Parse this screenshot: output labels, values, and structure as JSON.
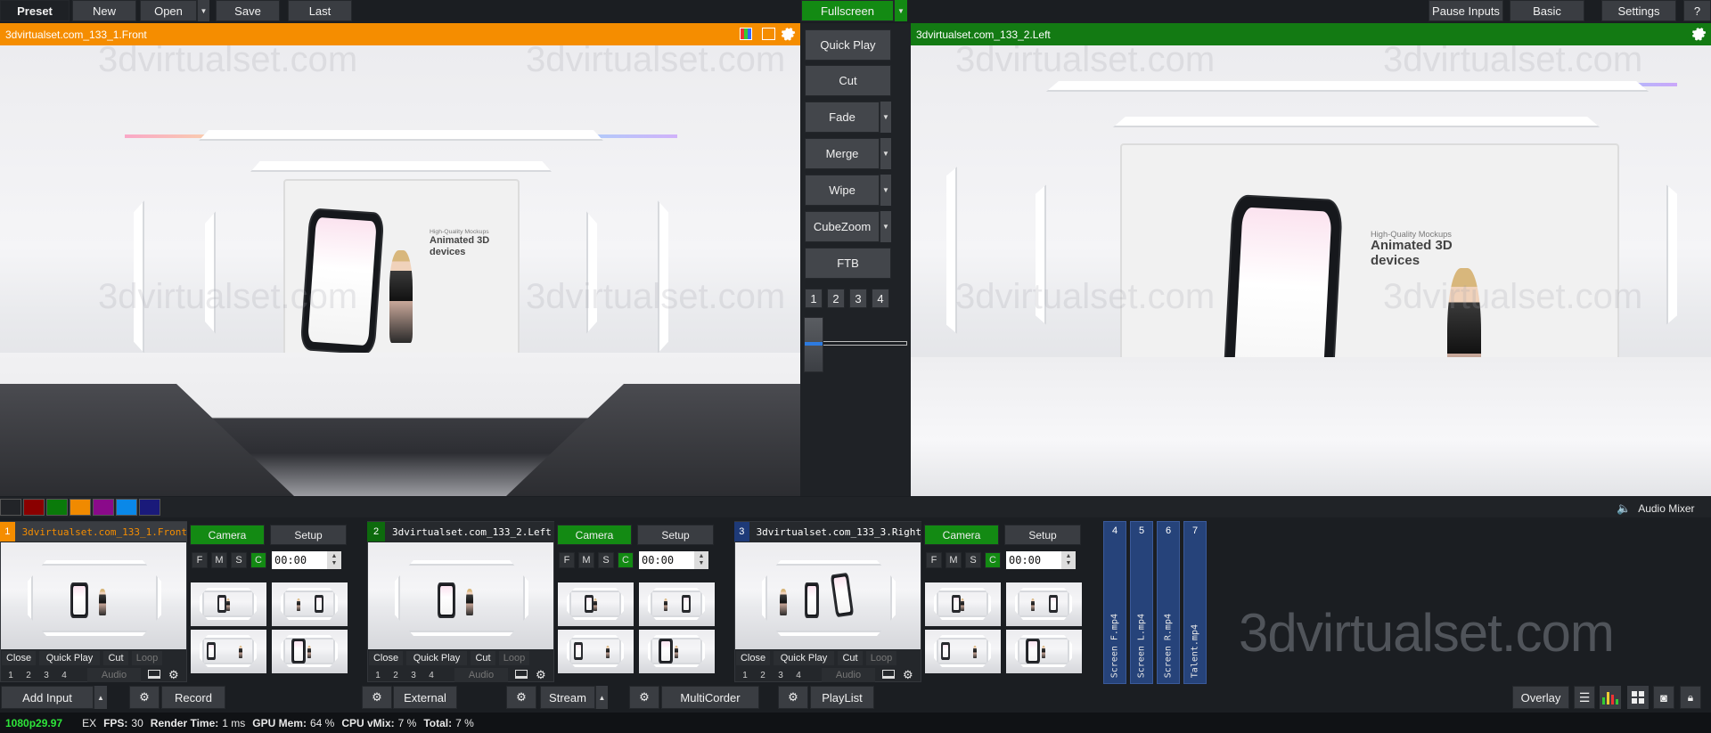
{
  "topbar": {
    "preset": "Preset",
    "new": "New",
    "open": "Open",
    "save": "Save",
    "last": "Last",
    "fullscreen": "Fullscreen",
    "pause_inputs": "Pause Inputs",
    "basic": "Basic",
    "settings": "Settings",
    "help": "?"
  },
  "preview": {
    "title": "3dvirtualset.com_133_1.Front",
    "color": "#f58d00"
  },
  "output": {
    "title": "3dvirtualset.com_133_2.Left",
    "color": "#137a13"
  },
  "scene_text": {
    "mockup_small": "High-Quality Mockups",
    "mockup_big": "Animated 3D devices",
    "watermark": "3dvirtualset.com"
  },
  "transitions": {
    "quick_play": "Quick Play",
    "cut": "Cut",
    "fade": "Fade",
    "merge": "Merge",
    "wipe": "Wipe",
    "cubezoom": "CubeZoom",
    "ftb": "FTB",
    "slots": [
      "1",
      "2",
      "3",
      "4"
    ]
  },
  "color_swatches": [
    "#222428",
    "#8a0000",
    "#0a7a0a",
    "#f08a00",
    "#8a0a8a",
    "#0a88e8",
    "#1a1a7a"
  ],
  "audio_mixer": "Audio Mixer",
  "inputs": [
    {
      "num": "1",
      "title": "3dvirtualset.com_133_1.Front",
      "color": "#f58d00",
      "title_color": "#f58d00"
    },
    {
      "num": "2",
      "title": "3dvirtualset.com_133_2.Left",
      "color": "#0d6a0d",
      "title_color": "#ffffff"
    },
    {
      "num": "3",
      "title": "3dvirtualset.com_133_3.Right",
      "color": "#1e3a78",
      "title_color": "#ffffff"
    }
  ],
  "input_controls": {
    "camera": "Camera",
    "setup": "Setup",
    "f": "F",
    "m": "M",
    "s": "S",
    "c": "C",
    "time": "00:00",
    "close": "Close",
    "quick_play": "Quick Play",
    "cut": "Cut",
    "loop": "Loop",
    "audio": "Audio",
    "nums": [
      "1",
      "2",
      "3",
      "4"
    ]
  },
  "vertical_inputs": [
    {
      "num": "4",
      "label": "Screen F.mp4"
    },
    {
      "num": "5",
      "label": "Screen L.mp4"
    },
    {
      "num": "6",
      "label": "Screen R.mp4"
    },
    {
      "num": "7",
      "label": "Talent.mp4"
    }
  ],
  "logo_text": "3dvirtualset.com",
  "bottombar": {
    "add_input": "Add Input",
    "record": "Record",
    "external": "External",
    "stream": "Stream",
    "multicorder": "MultiCorder",
    "playlist": "PlayList",
    "overlay": "Overlay"
  },
  "status": {
    "resolution": "1080p29.97",
    "ex": "EX",
    "fps_label": "FPS:",
    "fps": "30",
    "render_label": "Render Time:",
    "render": "1 ms",
    "gpu_label": "GPU Mem:",
    "gpu": "64 %",
    "cpu_label": "CPU vMix:",
    "cpu": "7 %",
    "total_label": "Total:",
    "total": "7 %"
  }
}
